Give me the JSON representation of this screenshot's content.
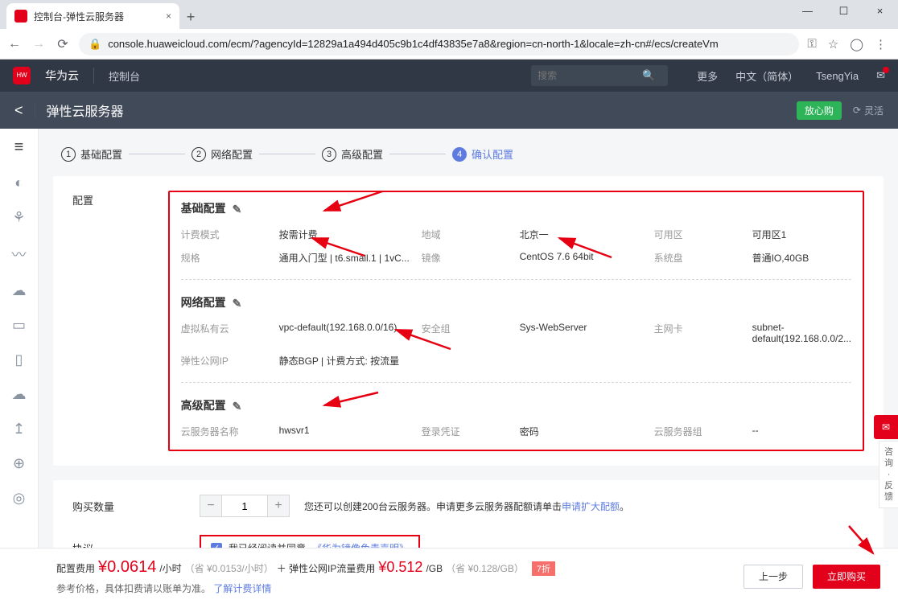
{
  "browser": {
    "tab_title": "控制台-弹性云服务器",
    "url": "console.huaweicloud.com/ecm/?agencyId=12829a1a494d405c9b1c4df43835e7a8&region=cn-north-1&locale=zh-cn#/ecs/createVm"
  },
  "header": {
    "brand": "华为云",
    "console": "控制台",
    "search_ph": "搜索",
    "more": "更多",
    "lang": "中文（简体）",
    "user": "TsengYia"
  },
  "subheader": {
    "back": "<",
    "title": "弹性云服务器",
    "relax": "放心购",
    "refresh": "灵活"
  },
  "steps": {
    "s1": "基础配置",
    "s2": "网络配置",
    "s3": "高级配置",
    "s4": "确认配置"
  },
  "cfg": {
    "left": "配置",
    "basic": {
      "title": "基础配置",
      "billing_l": "计费模式",
      "billing_v": "按需计费",
      "region_l": "地域",
      "region_v": "北京一",
      "az_l": "可用区",
      "az_v": "可用区1",
      "spec_l": "规格",
      "spec_v": "通用入门型 | t6.small.1 | 1vC...",
      "image_l": "镜像",
      "image_v": "CentOS 7.6 64bit",
      "disk_l": "系统盘",
      "disk_v": "普通IO,40GB"
    },
    "net": {
      "title": "网络配置",
      "vpc_l": "虚拟私有云",
      "vpc_v": "vpc-default(192.168.0.0/16)",
      "sg_l": "安全组",
      "sg_v": "Sys-WebServer",
      "nic_l": "主网卡",
      "nic_v": "subnet-default(192.168.0.0/2...",
      "eip_l": "弹性公网IP",
      "eip_v": "静态BGP | 计费方式: 按流量"
    },
    "adv": {
      "title": "高级配置",
      "name_l": "云服务器名称",
      "name_v": "hwsvr1",
      "login_l": "登录凭证",
      "login_v": "密码",
      "group_l": "云服务器组",
      "group_v": "--"
    }
  },
  "qty": {
    "label": "购买数量",
    "value": "1",
    "hint_a": "您还可以创建200台云服务器。申请更多云服务器配额请单击",
    "hint_link": "申请扩大配额",
    "hint_end": "。"
  },
  "agree": {
    "label": "协议",
    "text": "我已经阅读并同意",
    "link": "《华为镜像免责声明》"
  },
  "footer": {
    "cfg_l": "配置费用 ",
    "p1": "¥0.0614",
    "p1u": "/小时",
    "p1s": "（省 ¥0.0153/小时）",
    "plus": " ＋ 弹性公网IP流量费用 ",
    "p2": "¥0.512",
    "p2u": "/GB",
    "p2s": "（省 ¥0.128/GB）",
    "disc": "7折",
    "ref": "参考价格，具体扣费请以账单为准。",
    "ref_link": "了解计费详情",
    "prev": "上一步",
    "buy": "立即购买"
  },
  "side": {
    "feedback": "咨询 · 反馈"
  }
}
